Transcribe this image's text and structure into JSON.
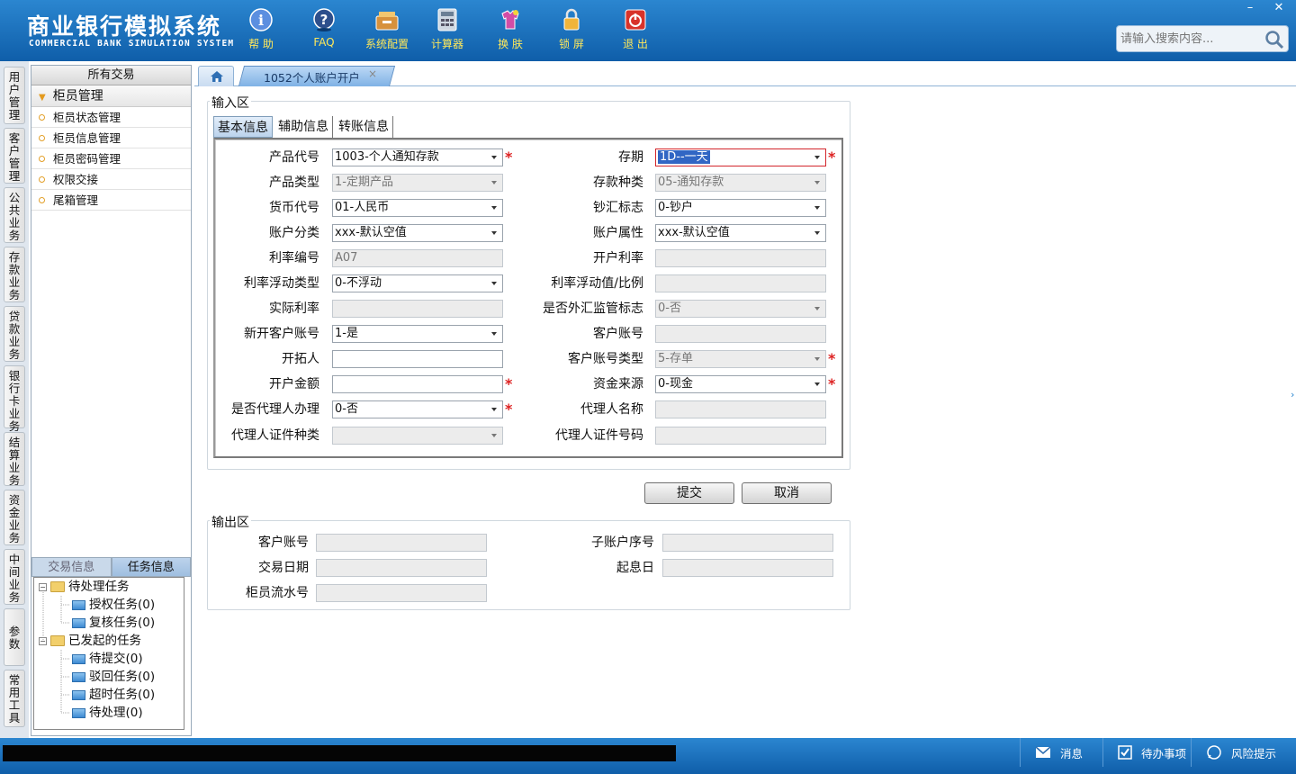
{
  "app": {
    "title_cn": "商业银行模拟系统",
    "title_en": "COMMERCIAL BANK SIMULATION SYSTEM"
  },
  "toolbar": [
    {
      "label": "帮 助",
      "icon": "help-icon"
    },
    {
      "label": "FAQ",
      "icon": "faq-icon"
    },
    {
      "label": "系统配置",
      "icon": "settings-icon"
    },
    {
      "label": "计算器",
      "icon": "calculator-icon"
    },
    {
      "label": "换 肤",
      "icon": "skin-icon"
    },
    {
      "label": "锁 屏",
      "icon": "lock-icon"
    },
    {
      "label": "退 出",
      "icon": "exit-icon"
    }
  ],
  "window": {
    "minimize": "–",
    "close": "✕"
  },
  "search": {
    "placeholder": "请输入搜索内容..."
  },
  "vertical_tabs": [
    "用户管理",
    "客户管理",
    "公共业务",
    "存款业务",
    "贷款业务",
    "银行卡业务",
    "结算业务",
    "资金业务",
    "中间业务",
    "参数",
    "常用工具"
  ],
  "left_panel": {
    "header": "所有交易",
    "group": "柜员管理",
    "items": [
      "柜员状态管理",
      "柜员信息管理",
      "柜员密码管理",
      "权限交接",
      "尾箱管理"
    ]
  },
  "task_panel": {
    "tabs": [
      "交易信息",
      "任务信息"
    ],
    "tree": [
      {
        "label": "待处理任务",
        "children": [
          "授权任务(0)",
          "复核任务(0)"
        ]
      },
      {
        "label": "已发起的任务",
        "children": [
          "待提交(0)",
          "驳回任务(0)",
          "超时任务(0)",
          "待处理(0)"
        ]
      }
    ]
  },
  "tab": {
    "current": "1052个人账户开户",
    "close": "×"
  },
  "input_section": {
    "legend": "输入区",
    "subtabs": [
      "基本信息",
      "辅助信息",
      "转账信息"
    ],
    "fields": {
      "product_code": {
        "label": "产品代号",
        "value": "1003-个人通知存款"
      },
      "term": {
        "label": "存期",
        "value": "1D--一天"
      },
      "product_type": {
        "label": "产品类型",
        "value": "1-定期产品"
      },
      "deposit_kind": {
        "label": "存款种类",
        "value": "05-通知存款"
      },
      "currency": {
        "label": "货币代号",
        "value": "01-人民币"
      },
      "cash_flag": {
        "label": "钞汇标志",
        "value": "0-钞户"
      },
      "account_class": {
        "label": "账户分类",
        "value": "xxx-默认空值"
      },
      "account_attr": {
        "label": "账户属性",
        "value": "xxx-默认空值"
      },
      "rate_code": {
        "label": "利率编号",
        "value": "A07"
      },
      "open_rate": {
        "label": "开户利率",
        "value": ""
      },
      "float_type": {
        "label": "利率浮动类型",
        "value": "0-不浮动"
      },
      "float_value": {
        "label": "利率浮动值/比例",
        "value": ""
      },
      "actual_rate": {
        "label": "实际利率",
        "value": ""
      },
      "fx_supervision": {
        "label": "是否外汇监管标志",
        "value": "0-否"
      },
      "new_customer": {
        "label": "新开客户账号",
        "value": "1-是"
      },
      "customer_account": {
        "label": "客户账号",
        "value": ""
      },
      "developer": {
        "label": "开拓人",
        "value": ""
      },
      "customer_account_type": {
        "label": "客户账号类型",
        "value": "5-存单"
      },
      "open_amount": {
        "label": "开户金额",
        "value": ""
      },
      "fund_source": {
        "label": "资金来源",
        "value": "0-现金"
      },
      "agent_flag": {
        "label": "是否代理人办理",
        "value": "0-否"
      },
      "agent_name": {
        "label": "代理人名称",
        "value": ""
      },
      "agent_id_type": {
        "label": "代理人证件种类",
        "value": ""
      },
      "agent_id_number": {
        "label": "代理人证件号码",
        "value": ""
      }
    },
    "required_mark": "*"
  },
  "actions": {
    "submit": "提交",
    "cancel": "取消"
  },
  "output_section": {
    "legend": "输出区",
    "fields": {
      "customer_account": {
        "label": "客户账号",
        "value": ""
      },
      "sub_account_seq": {
        "label": "子账户序号",
        "value": ""
      },
      "trade_date": {
        "label": "交易日期",
        "value": ""
      },
      "value_date": {
        "label": "起息日",
        "value": ""
      },
      "teller_serial": {
        "label": "柜员流水号",
        "value": ""
      }
    }
  },
  "statusbar": {
    "messages": "消息",
    "todo": "待办事项",
    "risk": "风险提示"
  },
  "colors": {
    "header_blue": "#1a6fbd",
    "required_red": "#d22222",
    "tool_label_yellow": "#ffe85a"
  }
}
